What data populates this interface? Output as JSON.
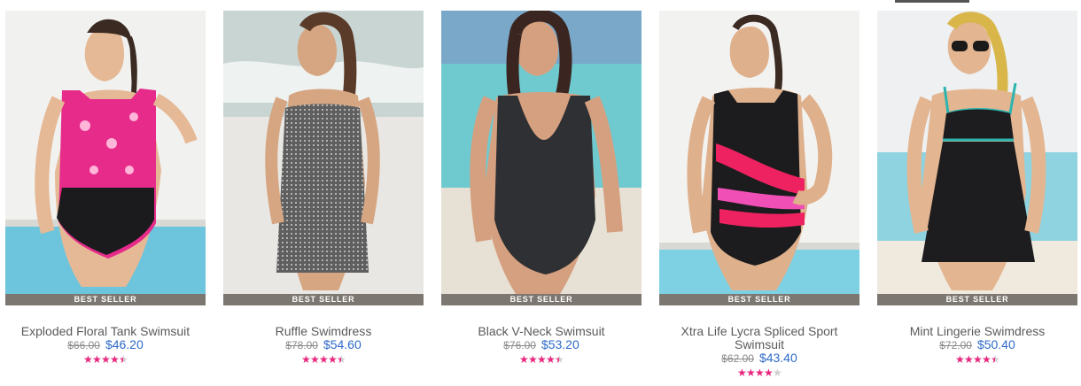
{
  "colors": {
    "badge_bg": "#7d7771",
    "price_new": "#2d6ac8",
    "star_on": "#e8267c",
    "star_off": "#cfcfcf"
  },
  "products": [
    {
      "name": "Exploded Floral Tank Swimsuit",
      "badge": "BEST SELLER",
      "old_price": "$66.00",
      "new_price": "$46.20",
      "rating": 4.5,
      "image": "pool-floral-pink-tank-swimsuit"
    },
    {
      "name": "Ruffle Swimdress",
      "badge": "BEST SELLER",
      "old_price": "$78.00",
      "new_price": "$54.60",
      "rating": 4.5,
      "image": "beach-gray-print-swimdress"
    },
    {
      "name": "Black V-Neck Swimsuit",
      "badge": "BEST SELLER",
      "old_price": "$76.00",
      "new_price": "$53.20",
      "rating": 4.5,
      "image": "beach-black-vneck-swimsuit"
    },
    {
      "name": "Xtra Life Lycra Spliced Sport Swimsuit",
      "badge": "BEST SELLER",
      "old_price": "$62.00",
      "new_price": "$43.40",
      "rating": 4,
      "image": "pool-black-pink-stripe-swimsuit"
    },
    {
      "name": "Mint Lingerie Swimdress",
      "badge": "BEST SELLER",
      "old_price": "$72.00",
      "new_price": "$50.40",
      "rating": 4.5,
      "image": "beach-black-mint-swimdress"
    }
  ]
}
